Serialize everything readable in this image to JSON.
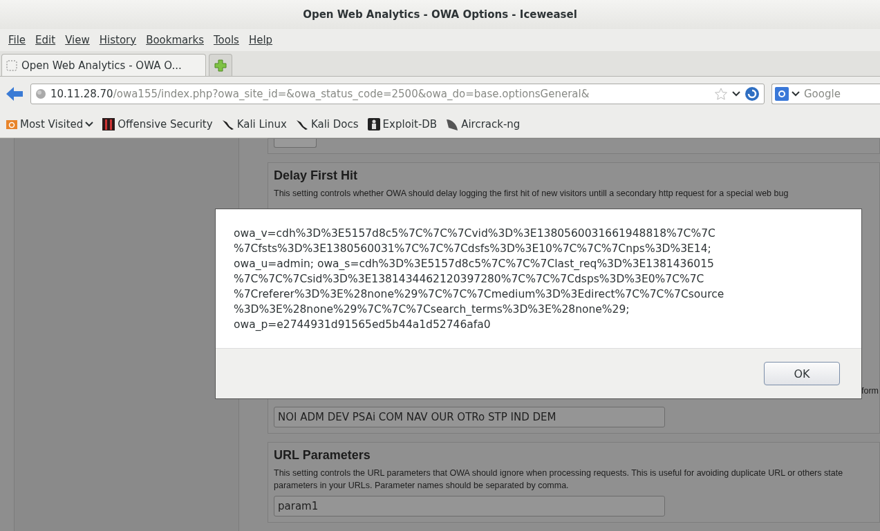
{
  "window": {
    "title": "Open Web Analytics - OWA Options - Iceweasel"
  },
  "menu": [
    "File",
    "Edit",
    "View",
    "History",
    "Bookmarks",
    "Tools",
    "Help"
  ],
  "tabs": [
    {
      "label": "Open Web Analytics - OWA O...",
      "selected": true
    }
  ],
  "address": {
    "host": "10.11.28.70",
    "path": "/owa155/index.php?owa_site_id=&owa_status_code=2500&owa_do=base.optionsGeneral&"
  },
  "search": {
    "placeholder": "Google"
  },
  "bookmarks": [
    {
      "label": "Most Visited",
      "kind": "folder"
    },
    {
      "label": "Offensive Security",
      "kind": "offsec"
    },
    {
      "label": "Kali Linux",
      "kind": "kali"
    },
    {
      "label": "Kali Docs",
      "kind": "kali"
    },
    {
      "label": "Exploit-DB",
      "kind": "exploit"
    },
    {
      "label": "Aircrack-ng",
      "kind": "aircrack"
    }
  ],
  "page": {
    "delay_card": {
      "title": "Delay First Hit",
      "description": "This setting controls whether OWA should delay logging the first hit of new visitors untill a secondary http request for a special web bug"
    },
    "hidden_card_fragment": "form",
    "p3p_field": {
      "value": "NOI ADM DEV PSAi COM NAV OUR OTRo STP IND DEM"
    },
    "url_card": {
      "title": "URL Parameters",
      "description": "This setting controls the URL parameters that OWA should ignore when processing requests. This is useful for avoiding duplicate URL or others state parameters in your URLs. Parameter names should be separated by comma.",
      "value": "param1"
    }
  },
  "dialog": {
    "message": [
      "owa_v=cdh%3D%3E5157d8c5%7C%7C%7Cvid%3D%3E1380560031661948818%7C%7C",
      "%7Cfsts%3D%3E1380560031%7C%7C%7Cdsfs%3D%3E10%7C%7C%7Cnps%3D%3E14;",
      "owa_u=admin; owa_s=cdh%3D%3E5157d8c5%7C%7C%7Clast_req%3D%3E1381436015",
      "%7C%7C%7Csid%3D%3E1381434462120397280%7C%7C%7Cdsps%3D%3E0%7C%7C",
      "%7Creferer%3D%3E%28none%29%7C%7C%7Cmedium%3D%3Edirect%7C%7C%7Csource",
      "%3D%3E%28none%29%7C%7C%7Csearch_terms%3D%3E%28none%29;",
      "owa_p=e2744931d91565ed5b44a1d52746afa0"
    ],
    "button": "OK"
  }
}
